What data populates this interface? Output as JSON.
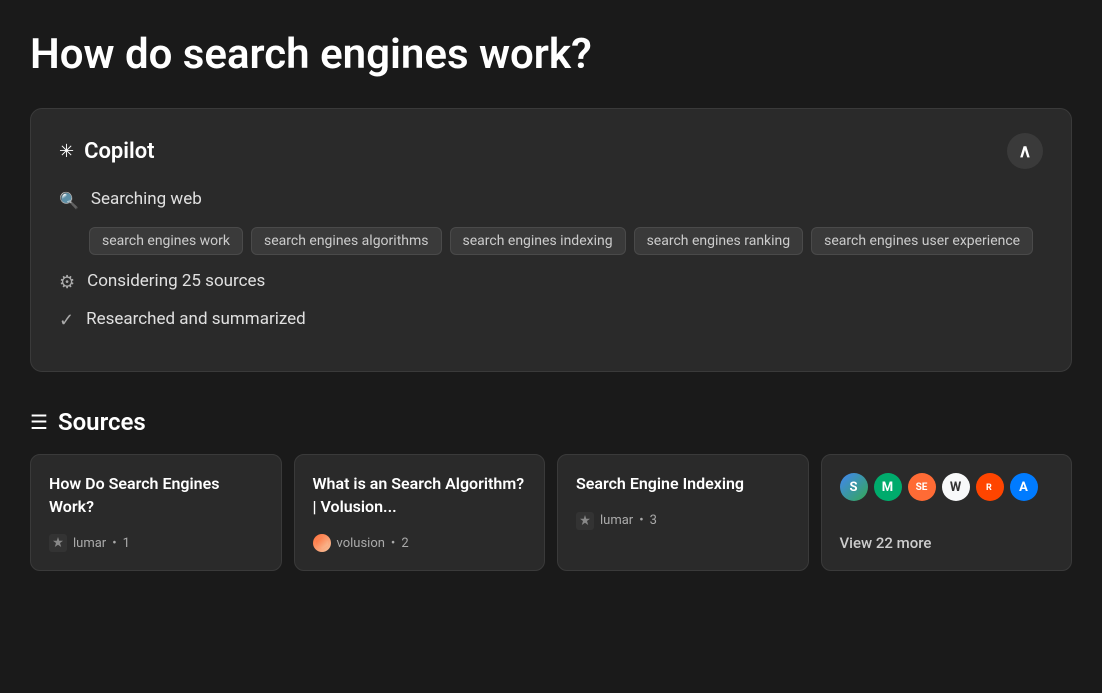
{
  "page": {
    "title": "How do search engines work?"
  },
  "copilot": {
    "title": "Copilot",
    "collapse_label": "collapse",
    "searching_label": "Searching web",
    "considering_label": "Considering 25 sources",
    "researched_label": "Researched and summarized",
    "tags": [
      {
        "id": "tag-1",
        "label": "search engines work"
      },
      {
        "id": "tag-2",
        "label": "search engines algorithms"
      },
      {
        "id": "tag-3",
        "label": "search engines indexing"
      },
      {
        "id": "tag-4",
        "label": "search engines ranking"
      },
      {
        "id": "tag-5",
        "label": "search engines user experience"
      }
    ]
  },
  "sources": {
    "title": "Sources",
    "cards": [
      {
        "id": "src-1",
        "title": "How Do Search Engines Work?",
        "logo_type": "lumar",
        "site_name": "lumar",
        "number": "1"
      },
      {
        "id": "src-2",
        "title": "What is an Search Algorithm? | Volusion...",
        "logo_type": "volusion",
        "site_name": "volusion",
        "number": "2"
      },
      {
        "id": "src-3",
        "title": "Search Engine Indexing",
        "logo_type": "lumar",
        "site_name": "lumar",
        "number": "3"
      }
    ],
    "more_card": {
      "view_more_text": "View 22 more",
      "favicons": [
        {
          "id": "fav-1",
          "label": "S",
          "class": "favicon-s"
        },
        {
          "id": "fav-2",
          "label": "M",
          "class": "favicon-m"
        },
        {
          "id": "fav-3",
          "label": "SE",
          "class": "favicon-se"
        },
        {
          "id": "fav-4",
          "label": "W",
          "class": "favicon-w"
        },
        {
          "id": "fav-5",
          "label": "R",
          "class": "favicon-r"
        },
        {
          "id": "fav-6",
          "label": "A",
          "class": "favicon-a"
        }
      ]
    }
  }
}
